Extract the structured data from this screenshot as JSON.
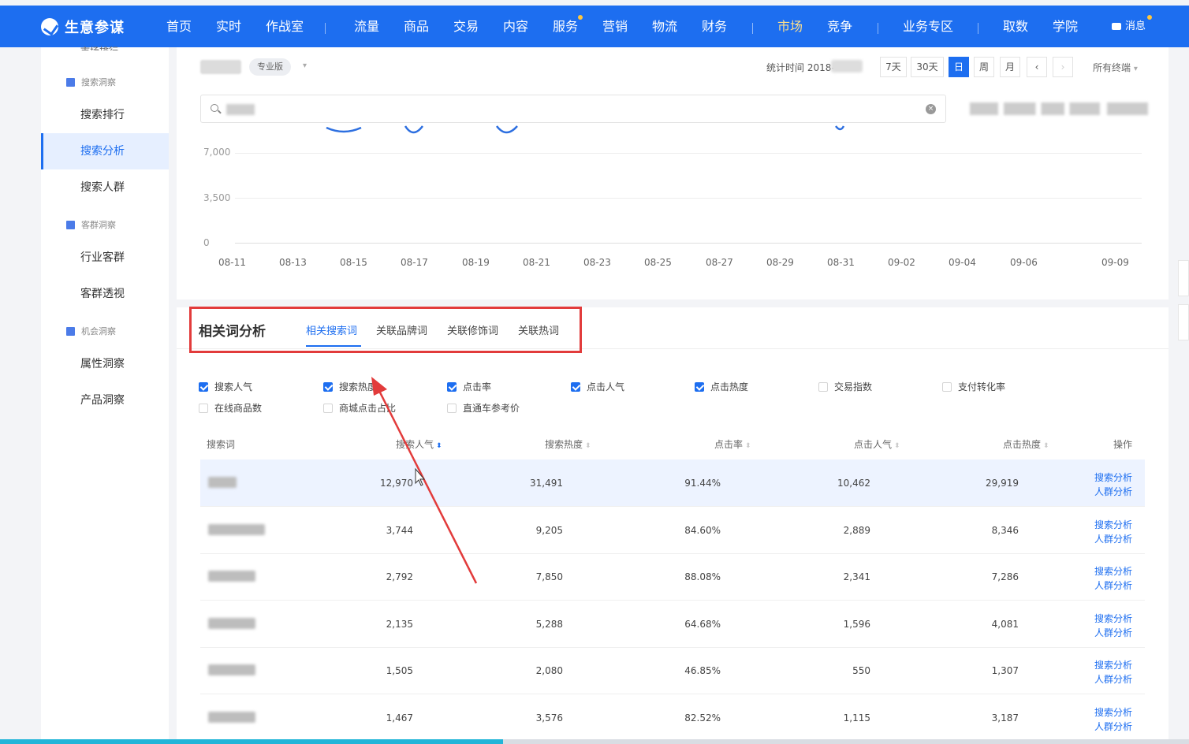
{
  "brand": {
    "name": "生意参谋"
  },
  "nav": {
    "items": [
      {
        "label": "首页"
      },
      {
        "label": "实时"
      },
      {
        "label": "作战室"
      },
      {
        "label": "流量"
      },
      {
        "label": "商品"
      },
      {
        "label": "交易"
      },
      {
        "label": "内容"
      },
      {
        "label": "服务"
      },
      {
        "label": "营销"
      },
      {
        "label": "物流"
      },
      {
        "label": "财务"
      },
      {
        "label": "市场"
      },
      {
        "label": "竞争"
      },
      {
        "label": "业务专区"
      },
      {
        "label": "取数"
      },
      {
        "label": "学院"
      }
    ],
    "active": "市场",
    "message": "消息"
  },
  "sidebar": {
    "cut_label": "市场排行",
    "groups": [
      {
        "label": "搜索洞察",
        "items": [
          {
            "label": "搜索排行"
          },
          {
            "label": "搜索分析"
          },
          {
            "label": "搜索人群"
          }
        ]
      },
      {
        "label": "客群洞察",
        "items": [
          {
            "label": "行业客群"
          },
          {
            "label": "客群透视"
          }
        ]
      },
      {
        "label": "机会洞察",
        "items": [
          {
            "label": "属性洞察"
          },
          {
            "label": "产品洞察"
          }
        ]
      }
    ],
    "active": "搜索分析"
  },
  "toolbar": {
    "edition": "专业版",
    "stat_time_label": "统计时间 2018-",
    "time_buttons": [
      "7天",
      "30天",
      "日",
      "周",
      "月",
      "‹",
      "›"
    ],
    "active_time": "日",
    "terminal": "所有终端"
  },
  "chart_data": {
    "type": "line",
    "y_ticks": [
      "7,000",
      "3,500",
      "0"
    ],
    "x_ticks": [
      "08-11",
      "08-13",
      "08-15",
      "08-17",
      "08-19",
      "08-21",
      "08-23",
      "08-25",
      "08-27",
      "08-29",
      "08-31",
      "09-02",
      "09-04",
      "09-06",
      "09-09"
    ]
  },
  "related": {
    "title": "相关词分析",
    "tabs": [
      {
        "label": "相关搜索词"
      },
      {
        "label": "关联品牌词"
      },
      {
        "label": "关联修饰词"
      },
      {
        "label": "关联热词"
      }
    ],
    "active_tab": "相关搜索词",
    "metrics": [
      {
        "label": "搜索人气",
        "checked": true
      },
      {
        "label": "搜索热度",
        "checked": true
      },
      {
        "label": "点击率",
        "checked": true
      },
      {
        "label": "点击人气",
        "checked": true
      },
      {
        "label": "点击热度",
        "checked": true
      },
      {
        "label": "交易指数",
        "checked": false
      },
      {
        "label": "支付转化率",
        "checked": false
      },
      {
        "label": "在线商品数",
        "checked": false
      },
      {
        "label": "商城点击占比",
        "checked": false
      },
      {
        "label": "直通车参考价",
        "checked": false
      }
    ],
    "columns": [
      "搜索词",
      "搜索人气",
      "搜索热度",
      "点击率",
      "点击人气",
      "点击热度",
      "操作"
    ],
    "rows": [
      {
        "search_pop": "12,970",
        "search_heat": "31,491",
        "ctr": "91.44%",
        "click_pop": "10,462",
        "click_heat": "29,919"
      },
      {
        "search_pop": "3,744",
        "search_heat": "9,205",
        "ctr": "84.60%",
        "click_pop": "2,889",
        "click_heat": "8,346"
      },
      {
        "search_pop": "2,792",
        "search_heat": "7,850",
        "ctr": "88.08%",
        "click_pop": "2,341",
        "click_heat": "7,286"
      },
      {
        "search_pop": "2,135",
        "search_heat": "5,288",
        "ctr": "64.68%",
        "click_pop": "1,596",
        "click_heat": "4,081"
      },
      {
        "search_pop": "1,505",
        "search_heat": "2,080",
        "ctr": "46.85%",
        "click_pop": "550",
        "click_heat": "1,307"
      },
      {
        "search_pop": "1,467",
        "search_heat": "3,576",
        "ctr": "82.52%",
        "click_pop": "1,115",
        "click_heat": "3,187"
      }
    ],
    "op_search": "搜索分析",
    "op_crowd": "人群分析"
  },
  "colors": {
    "brand": "#1d6ef0",
    "annotation": "#e23b3b"
  }
}
